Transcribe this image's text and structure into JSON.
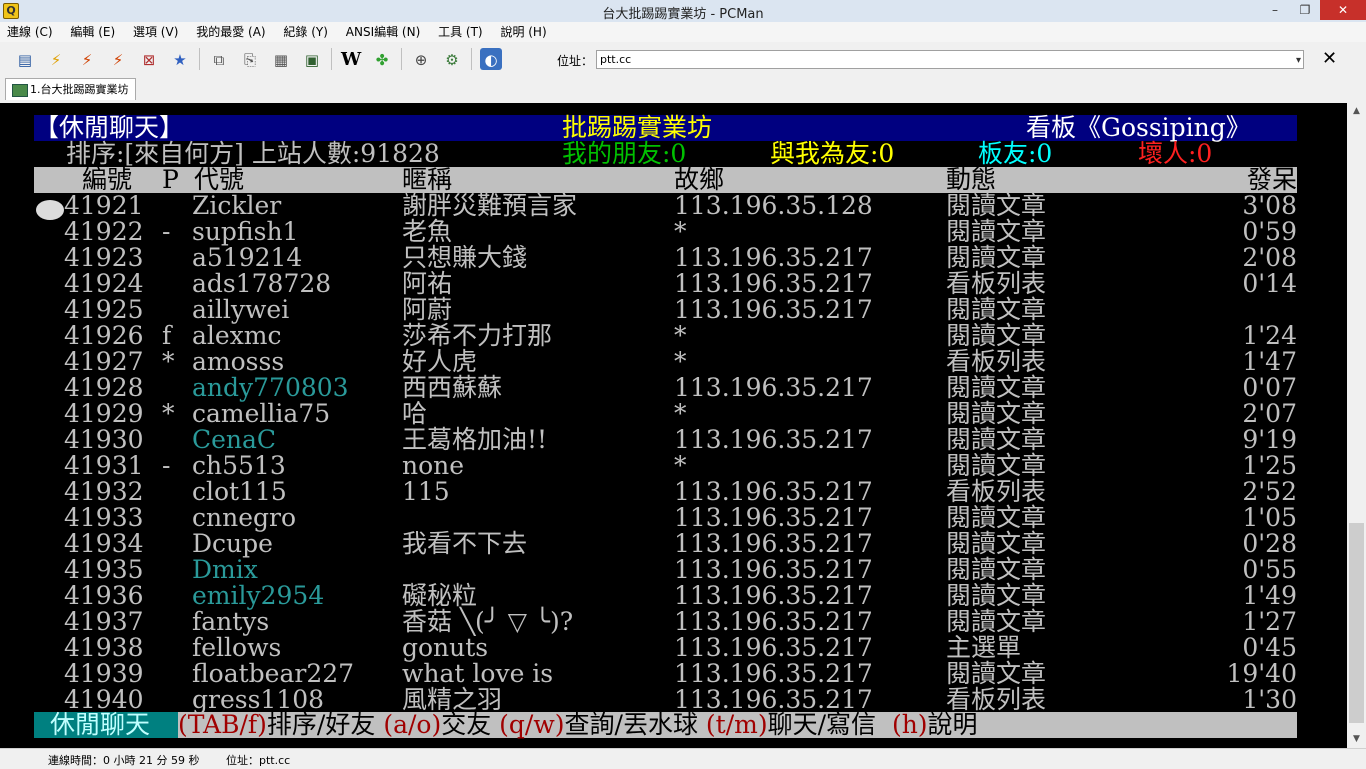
{
  "window": {
    "title": "台大批踢踢實業坊 - PCMan",
    "minimize": "–",
    "restore": "❐",
    "close": "✕"
  },
  "menu": [
    "連線 (C)",
    "編輯 (E)",
    "選項 (V)",
    "我的最愛 (A)",
    "紀錄 (Y)",
    "ANSI編輯 (N)",
    "工具 (T)",
    "說明 (H)"
  ],
  "address": {
    "label": "位址：",
    "value": "ptt.cc",
    "dropdown": "▾",
    "close": "✕"
  },
  "tab": {
    "label": "1.台大批踢踢實業坊"
  },
  "terminal": {
    "board_header": {
      "left": "【休閒聊天】",
      "center": "批踢踢實業坊",
      "right": "看板《Gossiping》"
    },
    "summary": {
      "sort": "排序:[來自何方] 上站人數:91828",
      "friends": "我的朋友:0",
      "friend_of": "與我為友:0",
      "board_friends": "板友:0",
      "bad": "壞人:0"
    },
    "columns": {
      "no": "編號",
      "p": "P",
      "id": "代號",
      "nick": "暱稱",
      "from": "故鄉",
      "status": "動態",
      "idle": "發呆"
    },
    "rows": [
      {
        "no": "41921",
        "p": "",
        "id": "Zickler",
        "nick": "謝胖災難預言家",
        "from": "113.196.35.128",
        "status": "閱讀文章",
        "idle": "3'08",
        "hl": false
      },
      {
        "no": "41922",
        "p": "-",
        "id": "supfish1",
        "nick": "老魚",
        "from": "*",
        "status": "閱讀文章",
        "idle": "0'59",
        "hl": false
      },
      {
        "no": "41923",
        "p": "",
        "id": "a519214",
        "nick": "只想賺大錢",
        "from": "113.196.35.217",
        "status": "閱讀文章",
        "idle": "2'08",
        "hl": false
      },
      {
        "no": "41924",
        "p": "",
        "id": "ads178728",
        "nick": "阿祐",
        "from": "113.196.35.217",
        "status": "看板列表",
        "idle": "0'14",
        "hl": false
      },
      {
        "no": "41925",
        "p": "",
        "id": "aillywei",
        "nick": "阿蔚",
        "from": "113.196.35.217",
        "status": "閱讀文章",
        "idle": "",
        "hl": false
      },
      {
        "no": "41926",
        "p": "f",
        "id": "alexmc",
        "nick": "莎希不力打那",
        "from": "*",
        "status": "閱讀文章",
        "idle": "1'24",
        "hl": false
      },
      {
        "no": "41927",
        "p": "*",
        "id": "amosss",
        "nick": "好人虎",
        "from": "*",
        "status": "看板列表",
        "idle": "1'47",
        "hl": false
      },
      {
        "no": "41928",
        "p": "",
        "id": "andy770803",
        "nick": "西西蘇蘇",
        "from": "113.196.35.217",
        "status": "閱讀文章",
        "idle": "0'07",
        "hl": true
      },
      {
        "no": "41929",
        "p": "*",
        "id": "camellia75",
        "nick": "哈",
        "from": "*",
        "status": "閱讀文章",
        "idle": "2'07",
        "hl": false
      },
      {
        "no": "41930",
        "p": "",
        "id": "CenaC",
        "nick": "王葛格加油!!",
        "from": "113.196.35.217",
        "status": "閱讀文章",
        "idle": "9'19",
        "hl": true
      },
      {
        "no": "41931",
        "p": "-",
        "id": "ch5513",
        "nick": "none",
        "from": "*",
        "status": "閱讀文章",
        "idle": "1'25",
        "hl": false
      },
      {
        "no": "41932",
        "p": "",
        "id": "clot115",
        "nick": "115",
        "from": "113.196.35.217",
        "status": "看板列表",
        "idle": "2'52",
        "hl": false
      },
      {
        "no": "41933",
        "p": "",
        "id": "cnnegro",
        "nick": "",
        "from": "113.196.35.217",
        "status": "閱讀文章",
        "idle": "1'05",
        "hl": false
      },
      {
        "no": "41934",
        "p": "",
        "id": "Dcupe",
        "nick": "我看不下去",
        "from": "113.196.35.217",
        "status": "閱讀文章",
        "idle": "0'28",
        "hl": false
      },
      {
        "no": "41935",
        "p": "",
        "id": "Dmix",
        "nick": "",
        "from": "113.196.35.217",
        "status": "閱讀文章",
        "idle": "0'55",
        "hl": true
      },
      {
        "no": "41936",
        "p": "",
        "id": "emily2954",
        "nick": "礙秘粒",
        "from": "113.196.35.217",
        "status": "閱讀文章",
        "idle": "1'49",
        "hl": true
      },
      {
        "no": "41937",
        "p": "",
        "id": "fantys",
        "nick": "香菇 ╲(╯ ▽ ╰)?",
        "from": "113.196.35.217",
        "status": "閱讀文章",
        "idle": "1'27",
        "hl": false
      },
      {
        "no": "41938",
        "p": "",
        "id": "fellows",
        "nick": "gonuts",
        "from": "113.196.35.217",
        "status": "主選單",
        "idle": "0'45",
        "hl": false
      },
      {
        "no": "41939",
        "p": "",
        "id": "floatbear227",
        "nick": "what love is",
        "from": "113.196.35.217",
        "status": "閱讀文章",
        "idle": "19'40",
        "hl": false
      },
      {
        "no": "41940",
        "p": "",
        "id": "gress1108",
        "nick": "風精之羽",
        "from": "113.196.35.217",
        "status": "看板列表",
        "idle": "1'30",
        "hl": false
      }
    ],
    "footer": {
      "mode": "休閒聊天",
      "k1": "(TAB/f)",
      "t1": "排序/好友",
      "k2": "(a/o)",
      "t2": "交友",
      "k3": "(q/w)",
      "t3": "查詢/丟水球",
      "k4": "(t/m)",
      "t4": "聊天/寫信",
      "k5": "(h)",
      "t5": "說明"
    }
  },
  "status": {
    "connected": "連線時間：0 小時 21 分 59 秒",
    "address": "位址：ptt.cc"
  },
  "colors": {
    "header_bg": "#000080",
    "header_fg": "#ffffff",
    "center_fg": "#ffff00",
    "col_header_bg": "#c0c0c0",
    "text": "#c0c0c0",
    "highlight": "#2a9a9a",
    "friends": "#00c000",
    "friend_of": "#ffff00",
    "board_friends": "#00ffff",
    "bad": "#ff2020",
    "footer_bg": "#c0c0c0",
    "footer_key": "#a00000",
    "footer_mode_bg": "#008080"
  }
}
